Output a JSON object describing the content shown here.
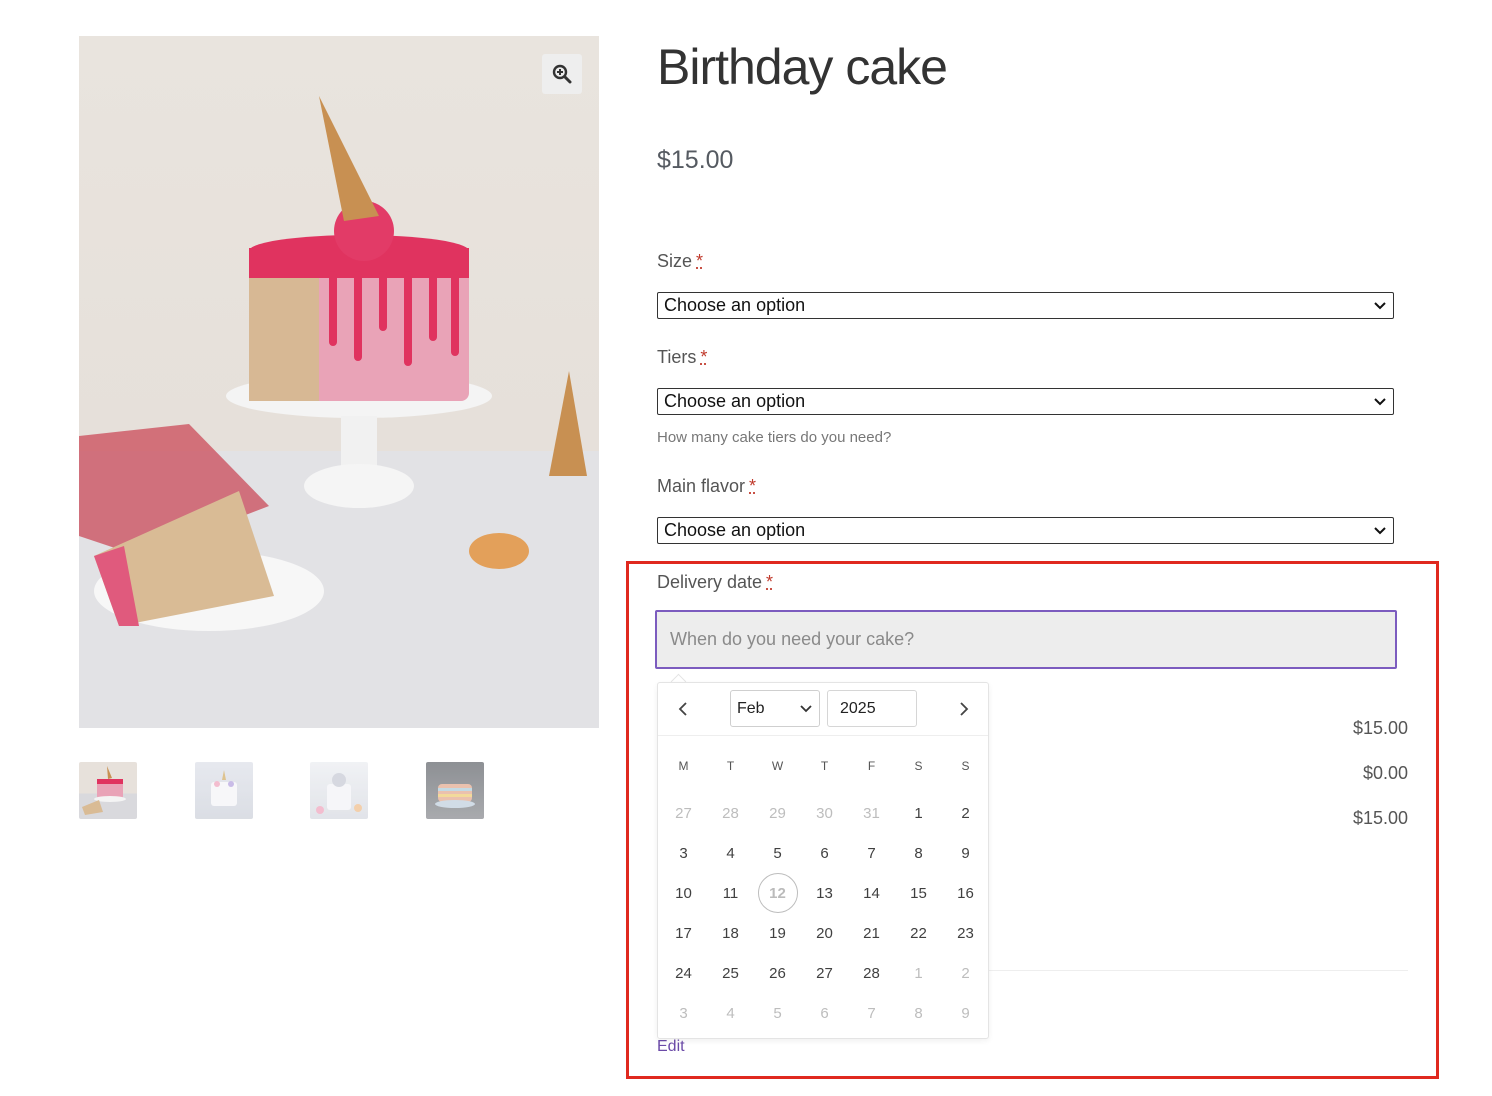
{
  "product": {
    "title": "Birthday cake",
    "price": "$15.00"
  },
  "gallery": {
    "main_image": "birthday-cake-photo",
    "zoom_icon": "magnifier-plus-icon",
    "thumbnails": [
      "thumbnail-1",
      "thumbnail-2",
      "thumbnail-3",
      "thumbnail-4"
    ]
  },
  "fields": {
    "size": {
      "label": "Size",
      "required": "*",
      "value": "Choose an option"
    },
    "tiers": {
      "label": "Tiers",
      "required": "*",
      "value": "Choose an option",
      "hint": "How many cake tiers do you need?"
    },
    "flavor": {
      "label": "Main flavor",
      "required": "*",
      "value": "Choose an option"
    },
    "delivery": {
      "label": "Delivery date",
      "required": "*",
      "placeholder": "When do you need your cake?"
    }
  },
  "datepicker": {
    "month": "Feb",
    "year": "2025",
    "weekdays": [
      "M",
      "T",
      "W",
      "T",
      "F",
      "S",
      "S"
    ],
    "today": "12",
    "days": [
      [
        "27",
        "28",
        "29",
        "30",
        "31",
        "1",
        "2"
      ],
      [
        "3",
        "4",
        "5",
        "6",
        "7",
        "8",
        "9"
      ],
      [
        "10",
        "11",
        "12",
        "13",
        "14",
        "15",
        "16"
      ],
      [
        "17",
        "18",
        "19",
        "20",
        "21",
        "22",
        "23"
      ],
      [
        "24",
        "25",
        "26",
        "27",
        "28",
        "1",
        "2"
      ],
      [
        "3",
        "4",
        "5",
        "6",
        "7",
        "8",
        "9"
      ]
    ]
  },
  "totals": {
    "line1": "$15.00",
    "line2": "$0.00",
    "line3": "$15.00"
  },
  "edit_label": "Edit",
  "colors": {
    "accent": "#7c5cbf",
    "highlight": "#e0291f",
    "required": "#c0392b"
  }
}
